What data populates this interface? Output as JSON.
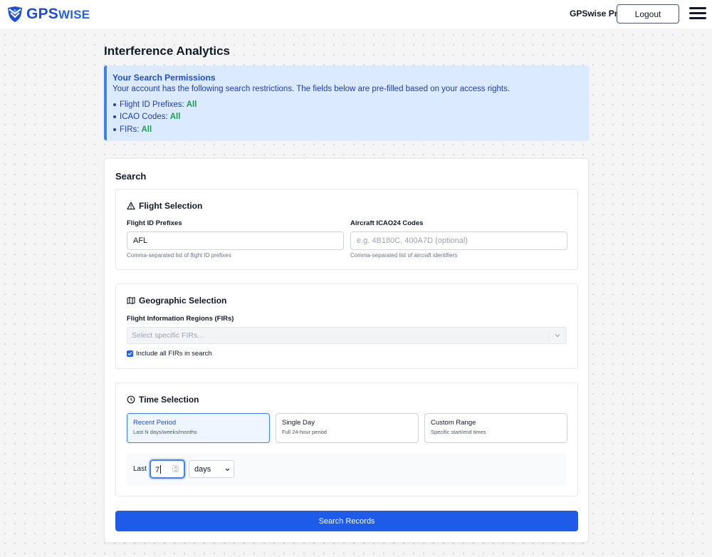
{
  "header": {
    "logo": {
      "text_primary": "GPS",
      "text_secondary": "WISE",
      "icon": "gpswise-shield-logo"
    },
    "plan_name": "GPSwise Pro",
    "logout_label": "Logout",
    "menu_icon": "hamburger-menu-icon"
  },
  "page": {
    "title": "Interference Analytics"
  },
  "permissions": {
    "title": "Your Search Permissions",
    "description": "Your account has the following search restrictions. The fields below are pre-filled based on your access rights.",
    "items": [
      {
        "label": "Flight ID Prefixes:",
        "value": "All"
      },
      {
        "label": "ICAO Codes:",
        "value": "All"
      },
      {
        "label": "FIRs:",
        "value": "All"
      }
    ],
    "value_color": "#16a34a"
  },
  "search": {
    "title": "Search",
    "flight_selection": {
      "heading": "Flight Selection",
      "icon": "warning-triangle-icon",
      "prefixes": {
        "label": "Flight ID Prefixes",
        "value": "AFL",
        "hint": "Comma-separated list of flight ID prefixes"
      },
      "icao": {
        "label": "Aircraft ICAO24 Codes",
        "value": "",
        "placeholder": "e.g. 4B180C, 400A7D (optional)",
        "hint": "Comma-separated list of aircraft identifiers"
      }
    },
    "geographic_selection": {
      "heading": "Geographic Selection",
      "icon": "map-icon",
      "firs": {
        "label": "Flight Information Regions (FIRs)",
        "placeholder": "Select specific FIRs...",
        "disabled": true
      },
      "include_all": {
        "label": "Include all FIRs in search",
        "checked": true
      }
    },
    "time_selection": {
      "heading": "Time Selection",
      "icon": "clock-icon",
      "options": [
        {
          "title": "Recent Period",
          "subtitle": "Last N days/weeks/months",
          "active": true
        },
        {
          "title": "Single Day",
          "subtitle": "Full 24-hour period",
          "active": false
        },
        {
          "title": "Custom Range",
          "subtitle": "Specific start/end times",
          "active": false
        }
      ],
      "recent": {
        "label": "Last",
        "value": "7",
        "unit": "days"
      }
    },
    "submit_label": "Search Records",
    "accent_color": "#1d5be8"
  }
}
